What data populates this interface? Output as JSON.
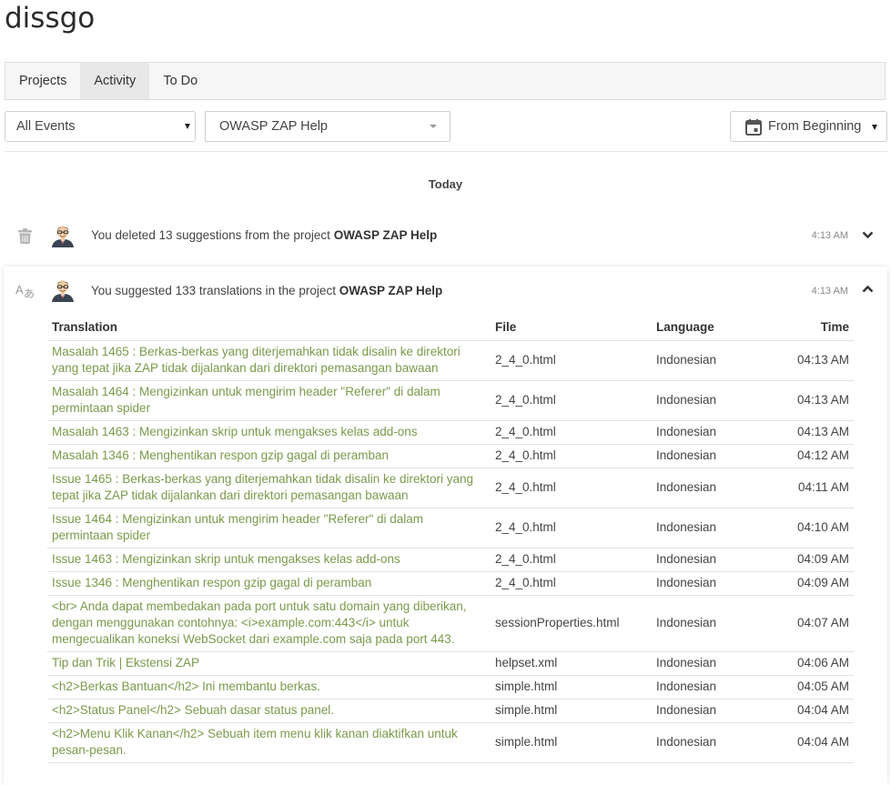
{
  "page": {
    "title": "dissgo"
  },
  "tabs": [
    {
      "label": "Projects",
      "active": false
    },
    {
      "label": "Activity",
      "active": true
    },
    {
      "label": "To Do",
      "active": false
    }
  ],
  "filters": {
    "events": "All Events",
    "project": "OWASP ZAP Help",
    "date": "From Beginning"
  },
  "timeline": {
    "day_label": "Today"
  },
  "events": [
    {
      "icon": "trash-icon",
      "text_prefix": "You deleted 13 suggestions from the project ",
      "project": "OWASP ZAP Help",
      "time": "4:13 AM",
      "expanded": false
    },
    {
      "icon": "translate-icon",
      "text_prefix": "You suggested 133 translations in the project ",
      "project": "OWASP ZAP Help",
      "time": "4:13 AM",
      "expanded": true
    }
  ],
  "translations": {
    "columns": [
      "Translation",
      "File",
      "Language",
      "Time"
    ],
    "rows": [
      {
        "translation": "Masalah 1465 : Berkas-berkas yang diterjemahkan tidak disalin ke direktori yang tepat jika ZAP tidak dijalankan dari direktori pemasangan bawaan",
        "file": "2_4_0.html",
        "language": "Indonesian",
        "time": "04:13 AM"
      },
      {
        "translation": "Masalah 1464 : Mengizinkan untuk mengirim header \"Referer\" di dalam permintaan spider",
        "file": "2_4_0.html",
        "language": "Indonesian",
        "time": "04:13 AM"
      },
      {
        "translation": "Masalah 1463 : Mengizinkan skrip untuk mengakses kelas add-ons",
        "file": "2_4_0.html",
        "language": "Indonesian",
        "time": "04:13 AM"
      },
      {
        "translation": "Masalah 1346 : Menghentikan respon gzip gagal di peramban",
        "file": "2_4_0.html",
        "language": "Indonesian",
        "time": "04:12 AM"
      },
      {
        "translation": "Issue 1465 : Berkas-berkas yang diterjemahkan tidak disalin ke direktori yang tepat jika ZAP tidak dijalankan dari direktori pemasangan bawaan",
        "file": "2_4_0.html",
        "language": "Indonesian",
        "time": "04:11 AM"
      },
      {
        "translation": "Issue 1464 : Mengizinkan untuk mengirim header \"Referer\" di dalam permintaan spider",
        "file": "2_4_0.html",
        "language": "Indonesian",
        "time": "04:10 AM"
      },
      {
        "translation": "Issue 1463 : Mengizinkan skrip untuk mengakses kelas add-ons",
        "file": "2_4_0.html",
        "language": "Indonesian",
        "time": "04:09 AM"
      },
      {
        "translation": "Issue 1346 : Menghentikan respon gzip gagal di peramban",
        "file": "2_4_0.html",
        "language": "Indonesian",
        "time": "04:09 AM"
      },
      {
        "translation": "<br> Anda dapat membedakan pada port untuk satu domain yang diberikan, dengan menggunakan contohnya: <i>example.com:443</i> untuk mengecualikan koneksi WebSocket dari example.com saja pada port 443.",
        "file": "sessionProperties.html",
        "language": "Indonesian",
        "time": "04:07 AM"
      },
      {
        "translation": "Tip dan Trik | Ekstensi ZAP",
        "file": "helpset.xml",
        "language": "Indonesian",
        "time": "04:06 AM"
      },
      {
        "translation": "<h2>Berkas Bantuan</h2> Ini membantu berkas.",
        "file": "simple.html",
        "language": "Indonesian",
        "time": "04:05 AM"
      },
      {
        "translation": "<h2>Status Panel</h2> Sebuah dasar status panel.",
        "file": "simple.html",
        "language": "Indonesian",
        "time": "04:04 AM"
      },
      {
        "translation": "<h2>Menu Klik Kanan</h2> Sebuah item menu klik kanan diaktifkan untuk pesan-pesan.",
        "file": "simple.html",
        "language": "Indonesian",
        "time": "04:04 AM"
      }
    ]
  }
}
